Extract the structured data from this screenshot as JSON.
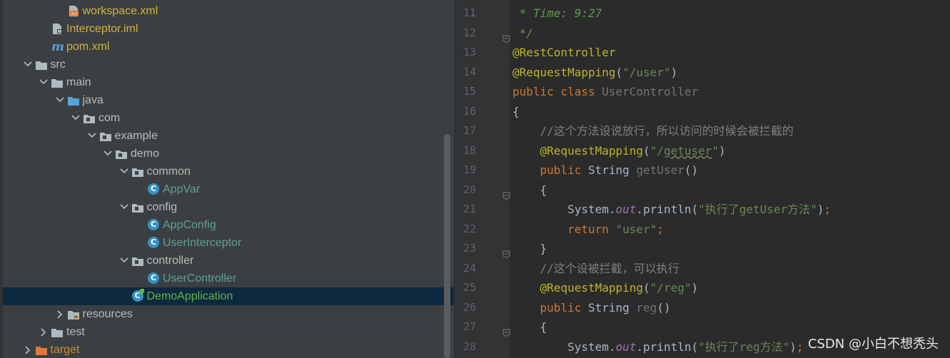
{
  "tree": {
    "rows": [
      {
        "label": "workspace.xml",
        "icon": "xml-file-icon",
        "color": "gold",
        "indent": 3,
        "arrow": "none"
      },
      {
        "label": "Interceptor.iml",
        "icon": "iml-file-icon",
        "color": "gold",
        "indent": 2,
        "arrow": "none"
      },
      {
        "label": "pom.xml",
        "icon": "maven-icon",
        "color": "gold",
        "indent": 2,
        "arrow": "none"
      },
      {
        "label": "src",
        "icon": "folder-icon",
        "color": "norm",
        "indent": 1,
        "arrow": "down"
      },
      {
        "label": "main",
        "icon": "folder-icon",
        "color": "norm",
        "indent": 2,
        "arrow": "down"
      },
      {
        "label": "java",
        "icon": "source-folder-icon",
        "color": "norm",
        "indent": 3,
        "arrow": "down"
      },
      {
        "label": "com",
        "icon": "package-icon",
        "color": "norm",
        "indent": 4,
        "arrow": "down"
      },
      {
        "label": "example",
        "icon": "package-icon",
        "color": "norm",
        "indent": 5,
        "arrow": "down"
      },
      {
        "label": "demo",
        "icon": "package-icon",
        "color": "norm",
        "indent": 6,
        "arrow": "down"
      },
      {
        "label": "common",
        "icon": "package-icon",
        "color": "norm",
        "indent": 7,
        "arrow": "down"
      },
      {
        "label": "AppVar",
        "icon": "class-icon",
        "color": "teal",
        "indent": 8,
        "arrow": "none"
      },
      {
        "label": "config",
        "icon": "package-icon",
        "color": "norm",
        "indent": 7,
        "arrow": "down"
      },
      {
        "label": "AppConfig",
        "icon": "class-icon",
        "color": "teal",
        "indent": 8,
        "arrow": "none"
      },
      {
        "label": "UserInterceptor",
        "icon": "class-icon",
        "color": "teal",
        "indent": 8,
        "arrow": "none"
      },
      {
        "label": "controller",
        "icon": "package-icon",
        "color": "norm",
        "indent": 7,
        "arrow": "down"
      },
      {
        "label": "UserController",
        "icon": "class-icon",
        "color": "teal",
        "indent": 8,
        "arrow": "none"
      },
      {
        "label": "DemoApplication",
        "icon": "spring-class-icon",
        "color": "green",
        "indent": 7,
        "arrow": "none",
        "selected": true
      },
      {
        "label": "resources",
        "icon": "resources-folder-icon",
        "color": "norm",
        "indent": 3,
        "arrow": "right"
      },
      {
        "label": "test",
        "icon": "folder-icon",
        "color": "norm",
        "indent": 2,
        "arrow": "right"
      },
      {
        "label": "target",
        "icon": "excluded-folder-icon",
        "color": "orange",
        "indent": 1,
        "arrow": "right"
      }
    ]
  },
  "editor": {
    "lines": [
      {
        "num": "11",
        "fold": false,
        "tokens": [
          [
            "doc",
            " * Time: 9:27"
          ]
        ]
      },
      {
        "num": "12",
        "fold": true,
        "tokens": [
          [
            "doc",
            " */"
          ]
        ]
      },
      {
        "num": "13",
        "fold": false,
        "tokens": [
          [
            "ann",
            "@RestController"
          ]
        ]
      },
      {
        "num": "14",
        "fold": false,
        "tokens": [
          [
            "ann",
            "@RequestMapping"
          ],
          [
            "id",
            "("
          ],
          [
            "str",
            "\"/user\""
          ],
          [
            "id",
            ")"
          ]
        ]
      },
      {
        "num": "15",
        "fold": false,
        "tokens": [
          [
            "kw",
            "public class "
          ],
          [
            "dim",
            "UserController"
          ]
        ]
      },
      {
        "num": "16",
        "fold": false,
        "tokens": [
          [
            "id",
            "{"
          ]
        ]
      },
      {
        "num": "17",
        "fold": false,
        "tokens": [
          [
            "cmt",
            "    //这个方法设说放行，所以访问的时候会被拦截的"
          ]
        ]
      },
      {
        "num": "18",
        "fold": false,
        "tokens": [
          [
            "ann",
            "    @RequestMapping"
          ],
          [
            "id",
            "("
          ],
          [
            "str",
            "\"/"
          ],
          [
            "sq",
            "getuser"
          ],
          [
            "str",
            "\""
          ],
          [
            "id",
            ")"
          ]
        ]
      },
      {
        "num": "19",
        "fold": false,
        "tokens": [
          [
            "kw",
            "    public "
          ],
          [
            "id",
            "String "
          ],
          [
            "dim",
            "getUser"
          ],
          [
            "id",
            "()"
          ]
        ]
      },
      {
        "num": "20",
        "fold": true,
        "tokens": [
          [
            "id",
            "    {"
          ]
        ]
      },
      {
        "num": "21",
        "fold": false,
        "tokens": [
          [
            "id",
            "        System."
          ],
          [
            "fld",
            "out"
          ],
          [
            "id",
            ".println("
          ],
          [
            "str",
            "\"执行了getUser方法\""
          ],
          [
            "id",
            ")"
          ],
          [
            "kw",
            ";"
          ]
        ]
      },
      {
        "num": "22",
        "fold": false,
        "tokens": [
          [
            "kw",
            "        return "
          ],
          [
            "str",
            "\"user\""
          ],
          [
            "kw",
            ";"
          ]
        ]
      },
      {
        "num": "23",
        "fold": true,
        "tokens": [
          [
            "id",
            "    }"
          ]
        ]
      },
      {
        "num": "24",
        "fold": false,
        "tokens": [
          [
            "cmt",
            "    //这个设被拦截，可以执行"
          ]
        ]
      },
      {
        "num": "25",
        "fold": false,
        "tokens": [
          [
            "ann",
            "    @RequestMapping"
          ],
          [
            "id",
            "("
          ],
          [
            "str",
            "\"/reg\""
          ],
          [
            "id",
            ")"
          ]
        ]
      },
      {
        "num": "26",
        "fold": false,
        "tokens": [
          [
            "kw",
            "    public "
          ],
          [
            "id",
            "String "
          ],
          [
            "dim",
            "reg"
          ],
          [
            "id",
            "()"
          ]
        ]
      },
      {
        "num": "27",
        "fold": true,
        "tokens": [
          [
            "id",
            "    {"
          ]
        ]
      },
      {
        "num": "28",
        "fold": false,
        "tokens": [
          [
            "id",
            "        System."
          ],
          [
            "fld",
            "out"
          ],
          [
            "id",
            ".println("
          ],
          [
            "str",
            "\"执行了reg方法\""
          ],
          [
            "id",
            ")"
          ],
          [
            "kw",
            ";"
          ]
        ]
      }
    ]
  },
  "watermark": "CSDN @小白不想秃头"
}
